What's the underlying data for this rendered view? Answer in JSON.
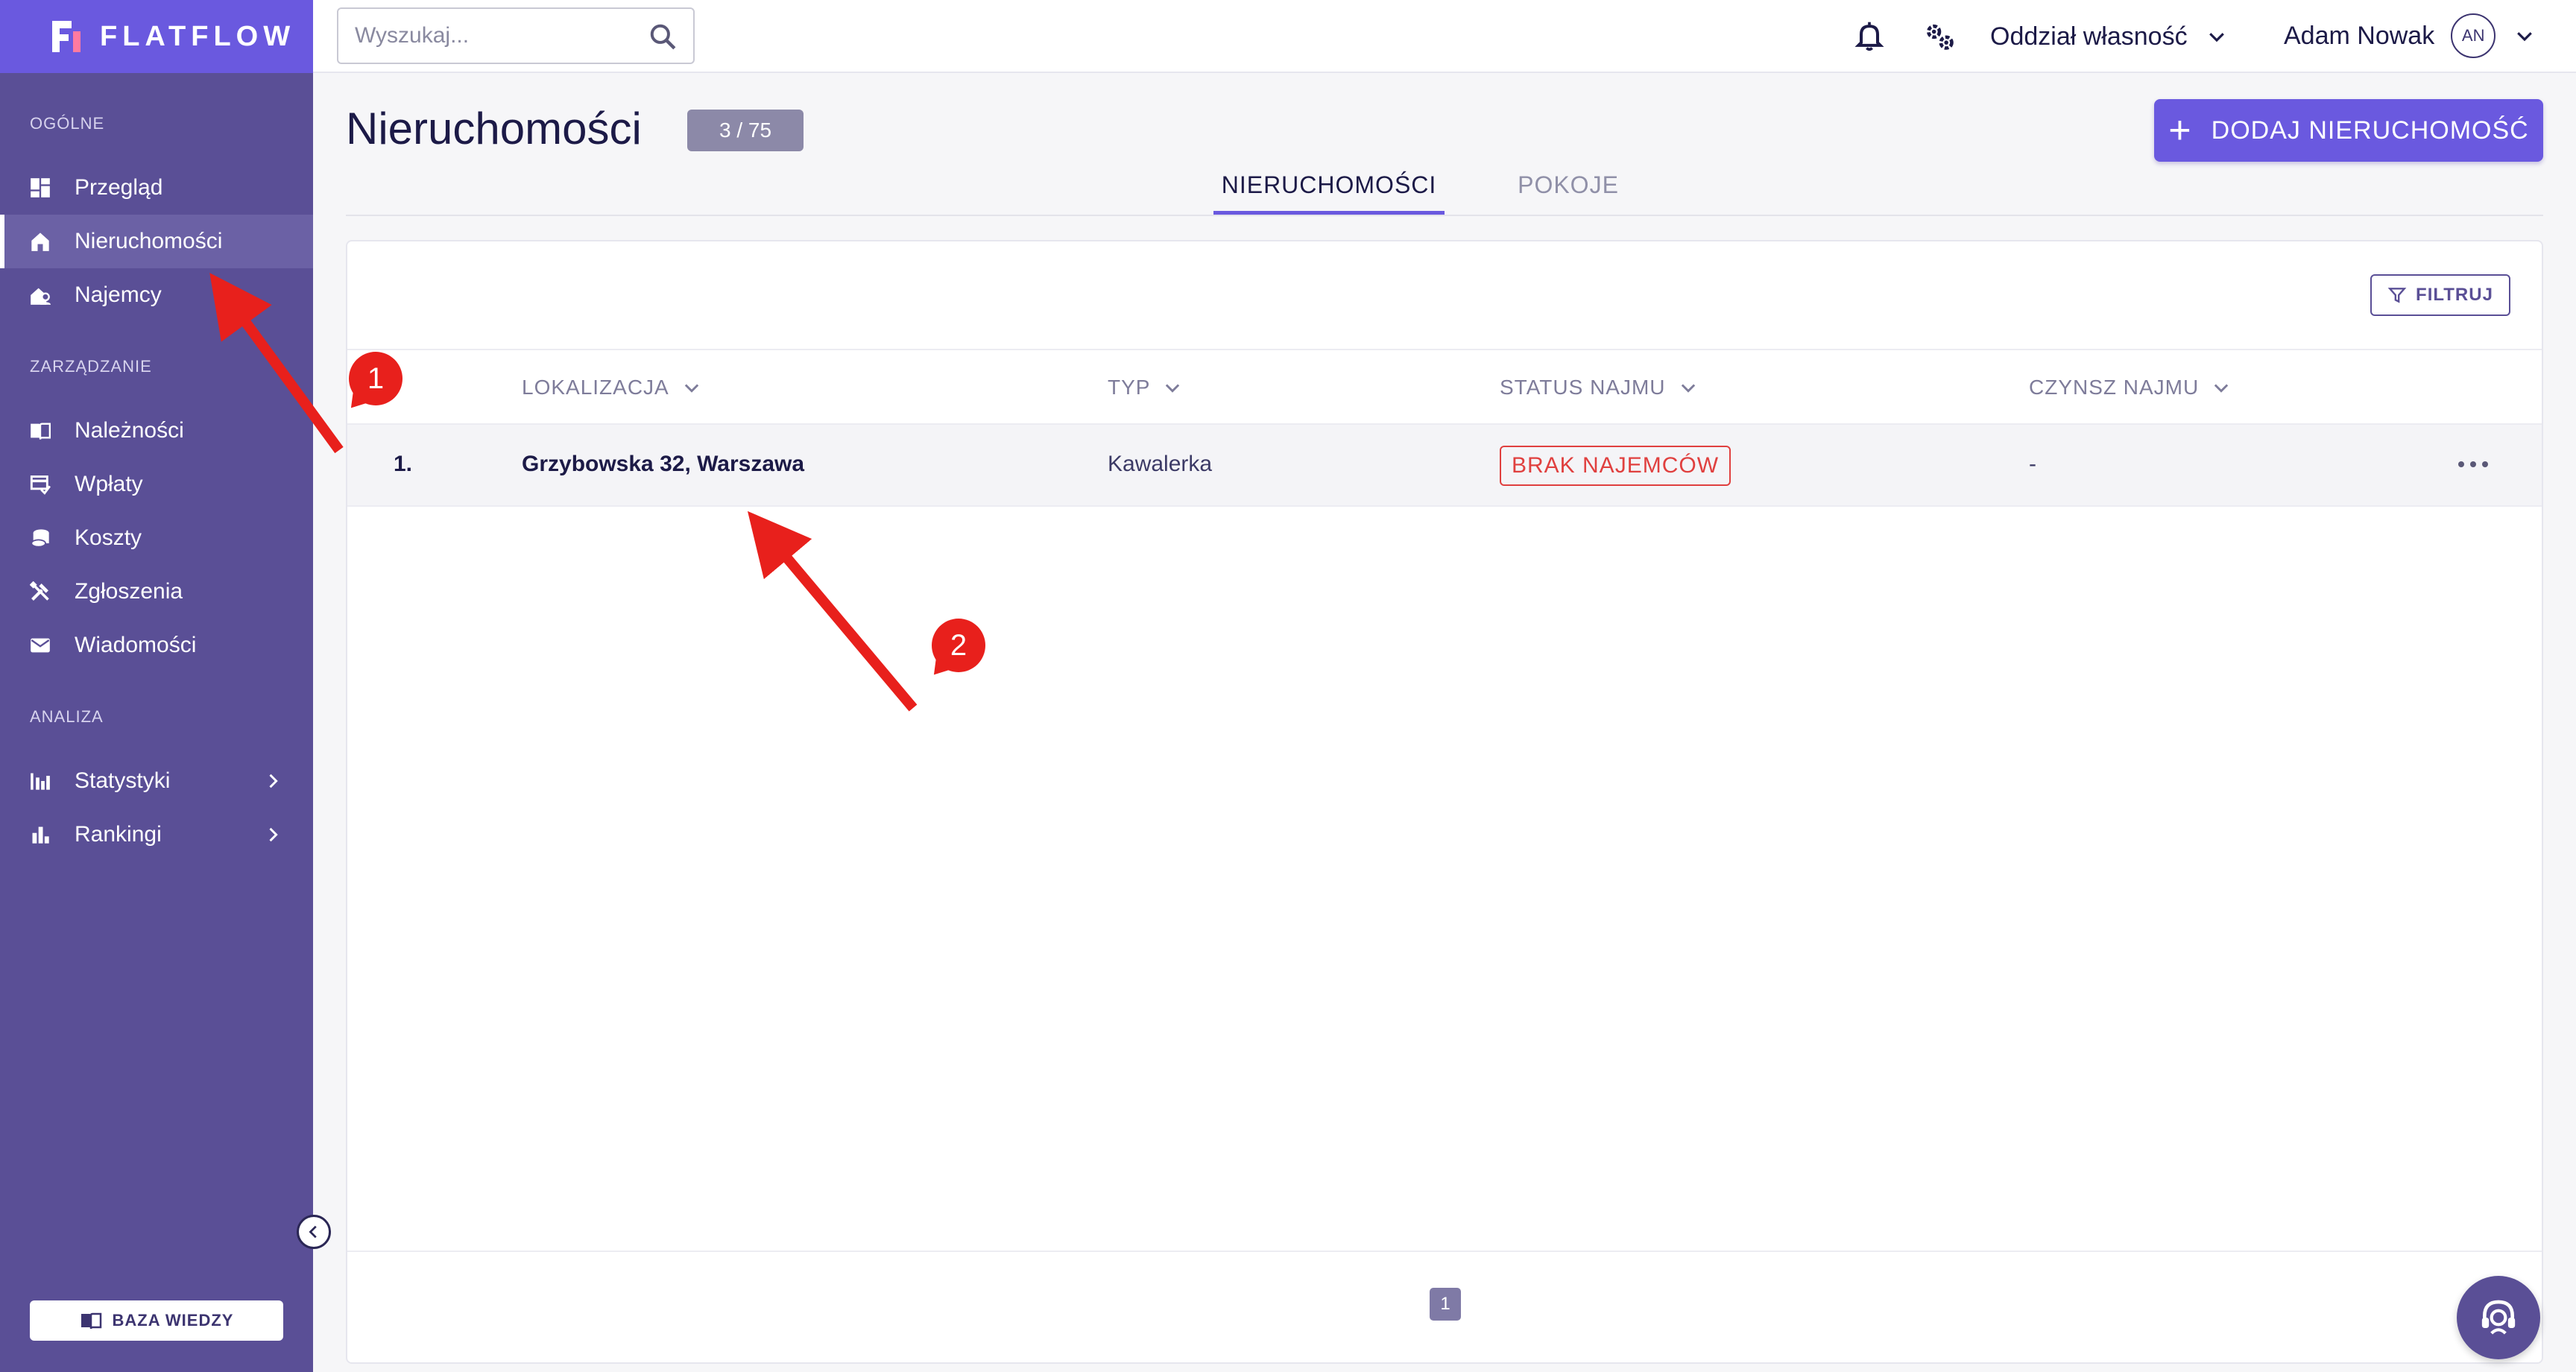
{
  "brand": {
    "name": "FLATFLOW"
  },
  "colors": {
    "sidebar": "#5a4f96",
    "brand_header": "#6a59df",
    "accent": "#6a59df",
    "status_red": "#e0403f",
    "annotation_red": "#e8201c"
  },
  "sidebar": {
    "sections": [
      {
        "label": "OGÓLNE",
        "items": [
          {
            "label": "Przegląd",
            "icon": "dashboard-icon",
            "active": false
          },
          {
            "label": "Nieruchomości",
            "icon": "home-icon",
            "active": true
          },
          {
            "label": "Najemcy",
            "icon": "user-home-icon",
            "active": false
          }
        ]
      },
      {
        "label": "ZARZĄDZANIE",
        "items": [
          {
            "label": "Należności",
            "icon": "book-icon",
            "active": false
          },
          {
            "label": "Wpłaty",
            "icon": "payment-icon",
            "active": false
          },
          {
            "label": "Koszty",
            "icon": "coins-icon",
            "active": false
          },
          {
            "label": "Zgłoszenia",
            "icon": "tools-icon",
            "active": false
          },
          {
            "label": "Wiadomości",
            "icon": "mail-icon",
            "active": false
          }
        ]
      },
      {
        "label": "ANALIZA",
        "items": [
          {
            "label": "Statystyki",
            "icon": "stats-icon",
            "expandable": true
          },
          {
            "label": "Rankingi",
            "icon": "bar-chart-icon",
            "expandable": true
          }
        ]
      }
    ],
    "knowledge_base_label": "BAZA WIEDZY"
  },
  "topbar": {
    "search_placeholder": "Wyszukaj...",
    "org_select_value": "Oddział własność",
    "user_name": "Adam Nowak",
    "user_initials": "AN"
  },
  "main": {
    "title": "Nieruchomości",
    "count_badge": "3 / 75",
    "add_button_label": "DODAJ NIERUCHOMOŚĆ",
    "tabs": [
      {
        "label": "NIERUCHOMOŚCI",
        "active": true
      },
      {
        "label": "POKOJE",
        "active": false
      }
    ],
    "filter_label": "FILTRUJ",
    "table": {
      "columns": [
        "LOKALIZACJA",
        "TYP",
        "STATUS NAJMU",
        "CZYNSZ NAJMU"
      ],
      "rows": [
        {
          "index": "1.",
          "location": "Grzybowska 32, Warszawa",
          "type": "Kawalerka",
          "status": "BRAK NAJEMCÓW",
          "rent": "-"
        }
      ]
    },
    "pagination": {
      "current_page": "1"
    }
  },
  "annotations": [
    {
      "number": "1"
    },
    {
      "number": "2"
    }
  ]
}
